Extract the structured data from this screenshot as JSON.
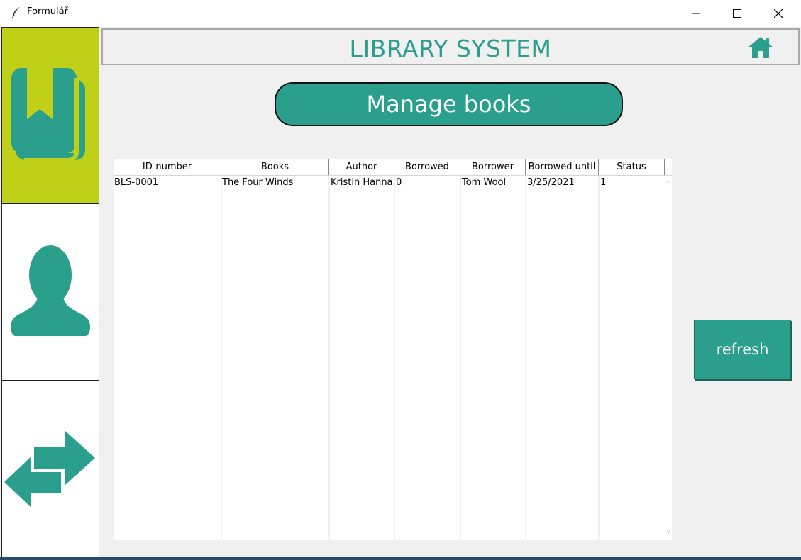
{
  "window": {
    "title": "Formulář",
    "icon": "feather-icon",
    "controls": [
      "minimize-icon",
      "maximize-icon",
      "close-icon"
    ]
  },
  "colors": {
    "accent": "#2aa08c",
    "sidebar_active": "#c0cf17",
    "background": "#f0f0f0"
  },
  "sidebar": {
    "items": [
      {
        "name": "books",
        "icon": "book-icon",
        "active": true
      },
      {
        "name": "users",
        "icon": "user-icon",
        "active": false
      },
      {
        "name": "transfer",
        "icon": "swap-arrows-icon",
        "active": false
      }
    ]
  },
  "header": {
    "title": "LIBRARY SYSTEM",
    "home_icon": "home-icon"
  },
  "main": {
    "manage_label": "Manage books",
    "refresh_label": "refresh"
  },
  "table": {
    "columns": [
      "ID-number",
      "Books",
      "Author",
      "Borrowed",
      "Borrower",
      "Borrowed until",
      "Status"
    ],
    "rows": [
      [
        "BLS-0001",
        "The Four Winds",
        "Kristin Hanna",
        "0",
        "Tom Wool",
        "3/25/2021",
        "1"
      ]
    ]
  }
}
